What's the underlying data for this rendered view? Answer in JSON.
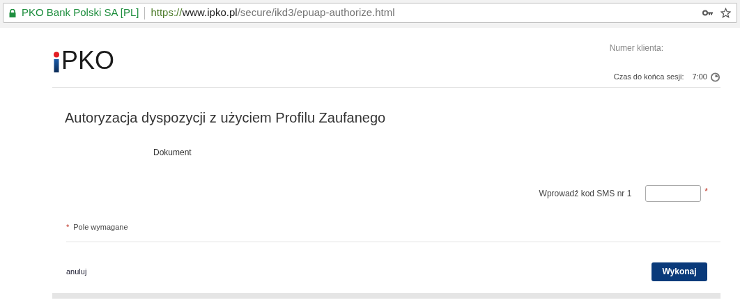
{
  "browser": {
    "site_identity": "PKO Bank Polski SA [PL]",
    "url_scheme": "https://",
    "url_host": "www.ipko.pl",
    "url_path": "/secure/ikd3/epuap-authorize.html"
  },
  "header": {
    "logo_text": "PKO",
    "client_number_label": "Numer klienta:",
    "session_label": "Czas do końca sesji:",
    "session_time": "7:00"
  },
  "title": "Autoryzacja dyspozycji z użyciem Profilu Zaufanego",
  "document_label": "Dokument",
  "sms_field": {
    "label": "Wprowadź kod SMS nr 1",
    "required_mark": "*"
  },
  "required_note": {
    "mark": "*",
    "text": "Pole wymagane"
  },
  "actions": {
    "cancel": "anuluj",
    "submit": "Wykonaj"
  }
}
